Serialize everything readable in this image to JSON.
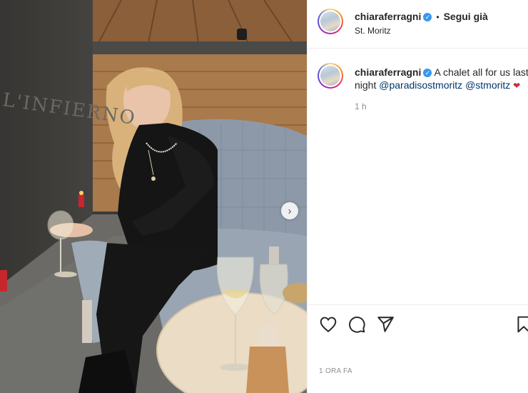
{
  "post": {
    "username": "chiaraferragni",
    "verified_mark": "✓",
    "separator": "•",
    "follow_label": "Segui già",
    "location": "St. Moritz"
  },
  "caption": {
    "username": "chiaraferragni",
    "text_before": "A chalet all for us last night",
    "mention_1": "@paradisostmoritz",
    "mention_2": "@stmoritz",
    "emoji": "❤",
    "relative_time": "1 h"
  },
  "photo": {
    "wall_sign": "L'INFIERNO",
    "next_arrow": "›"
  },
  "actions": {
    "icons": [
      "heart-icon",
      "comment-icon",
      "share-icon",
      "bookmark-icon"
    ]
  },
  "footer": {
    "timestamp": "1 ORA FA"
  },
  "colors": {
    "link": "#00376b",
    "verified": "#3897f0",
    "muted": "#8e8e8e"
  }
}
